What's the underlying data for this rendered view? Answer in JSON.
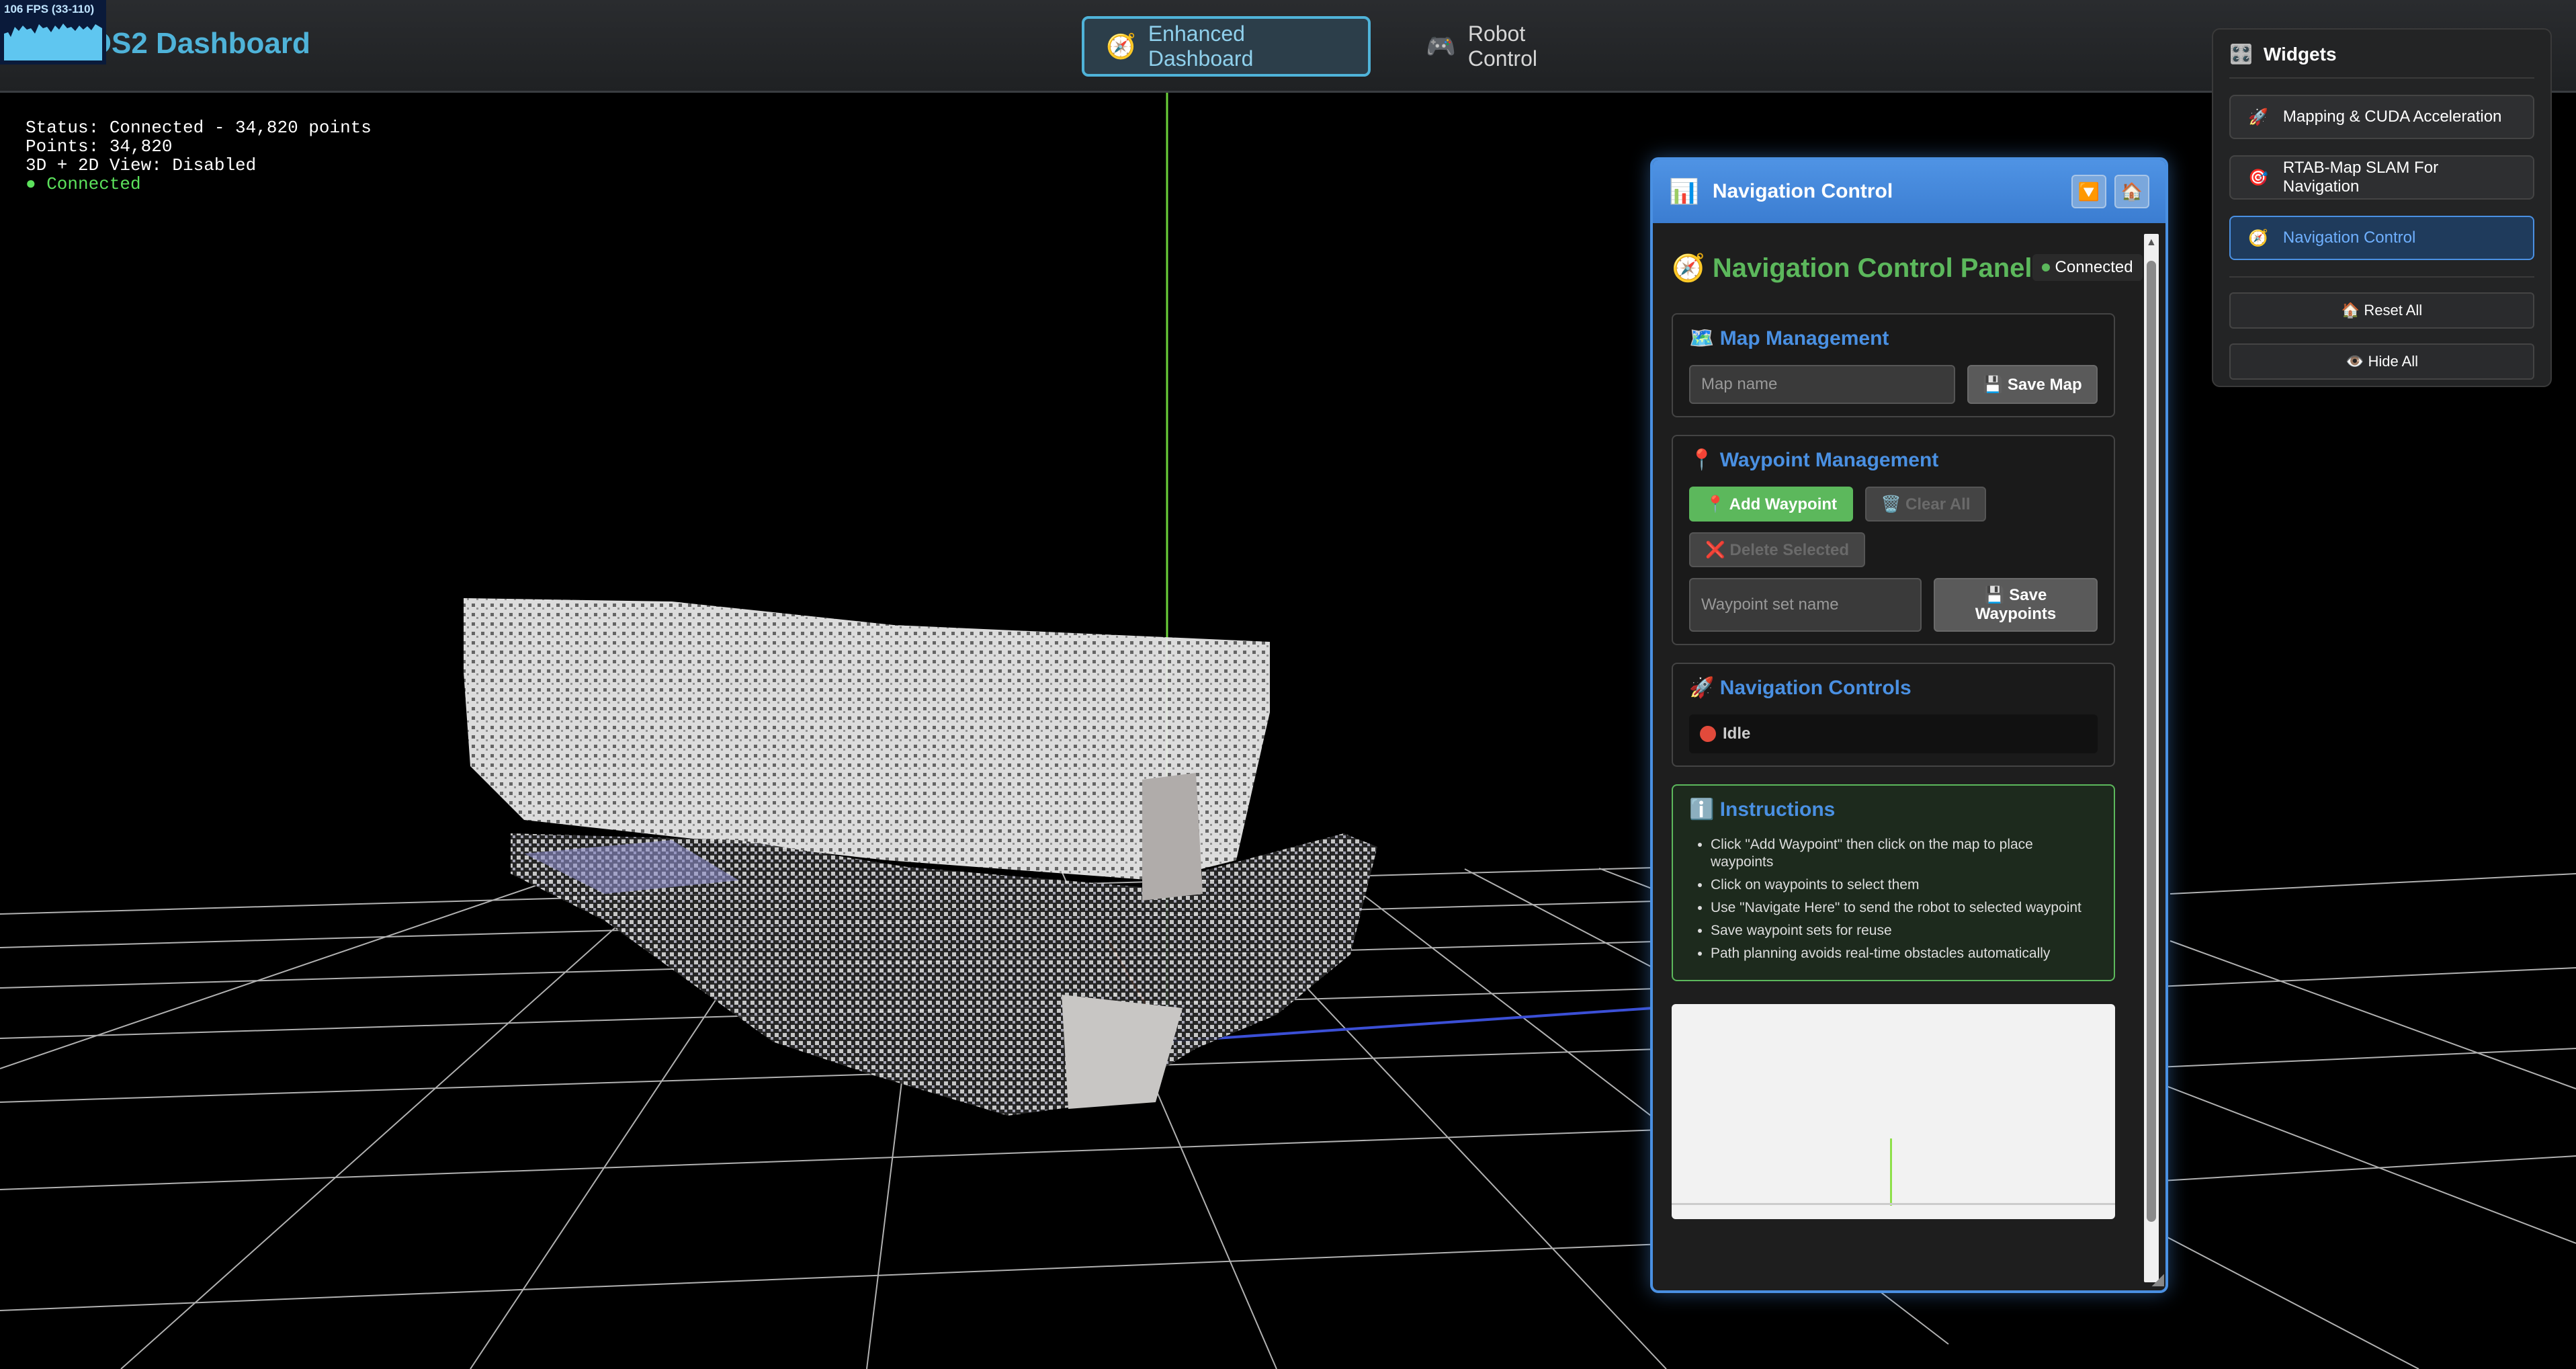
{
  "header": {
    "fps": "106 FPS (33-110)",
    "title": "ROS2 Dashboard",
    "tabs": [
      {
        "label": "Enhanced Dashboard",
        "icon": "🧭",
        "active": true
      },
      {
        "label": "Robot Control",
        "icon": "🎮",
        "active": false
      }
    ]
  },
  "status": {
    "line1": "Status: Connected - 34,820 points",
    "line2": "Points: 34,820",
    "line3": "3D + 2D View: Disabled",
    "line4": "● Connected"
  },
  "nav_panel": {
    "header_icon": "📊",
    "title": "Navigation Control",
    "collapse_icon": "🔽",
    "home_icon": "🏠",
    "control_title": "🧭 Navigation Control Panel",
    "connection": "Connected",
    "map_section": {
      "title": "🗺️ Map Management",
      "input_placeholder": "Map name",
      "save_label": "💾 Save Map"
    },
    "waypoint_section": {
      "title": "📍 Waypoint Management",
      "add_label": "📍 Add Waypoint",
      "clear_label": "🗑️ Clear All",
      "delete_label": "❌ Delete Selected",
      "set_placeholder": "Waypoint set name",
      "save_label": "💾 Save Waypoints"
    },
    "controls_section": {
      "title": "🚀 Navigation Controls",
      "state": "Idle"
    },
    "instructions": {
      "title": "ℹ️ Instructions",
      "items": [
        "Click \"Add Waypoint\" then click on the map to place waypoints",
        "Click on waypoints to select them",
        "Use \"Navigate Here\" to send the robot to selected waypoint",
        "Save waypoint sets for reuse",
        "Path planning avoids real-time obstacles automatically"
      ]
    }
  },
  "widgets": {
    "title": "Widgets",
    "icon": "🎛️",
    "items": [
      {
        "icon": "🚀",
        "label": "Mapping & CUDA Acceleration",
        "active": false
      },
      {
        "icon": "🎯",
        "label": "RTAB-Map SLAM For Navigation",
        "active": false
      },
      {
        "icon": "🧭",
        "label": "Navigation Control",
        "active": true
      }
    ],
    "reset_label": "🏠 Reset All",
    "hide_label": "👁️ Hide All"
  },
  "colors": {
    "accent": "#4a90e2",
    "title": "#4fb3d9",
    "success": "#5cb85c",
    "danger": "#e24a3b"
  }
}
